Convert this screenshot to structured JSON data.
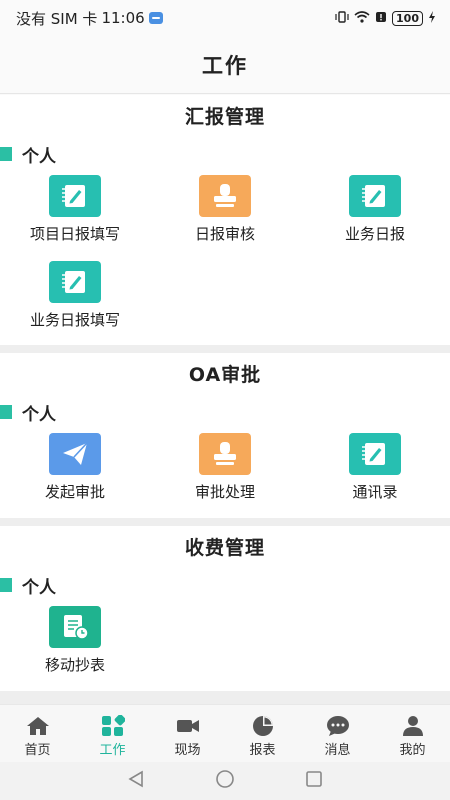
{
  "status_bar": {
    "carrier": "没有 SIM 卡",
    "time": "11:06",
    "battery": "100"
  },
  "header": {
    "title": "工作"
  },
  "sections": [
    {
      "title": "汇报管理",
      "group": "个人",
      "items": [
        {
          "label": "项目日报填写",
          "icon": "notebook-edit-icon",
          "color": "#27bfb1"
        },
        {
          "label": "日报审核",
          "icon": "stamp-icon",
          "color": "#f6a95a"
        },
        {
          "label": "业务日报",
          "icon": "notebook-edit-icon",
          "color": "#27bfb1"
        },
        {
          "label": "业务日报填写",
          "icon": "notebook-edit-icon",
          "color": "#27bfb1"
        }
      ]
    },
    {
      "title": "OA审批",
      "group": "个人",
      "items": [
        {
          "label": "发起审批",
          "icon": "paper-plane-icon",
          "color": "#5b9ae9"
        },
        {
          "label": "审批处理",
          "icon": "stamp-icon",
          "color": "#f6a95a"
        },
        {
          "label": "通讯录",
          "icon": "notebook-edit-icon",
          "color": "#27bfb1"
        }
      ]
    },
    {
      "title": "收费管理",
      "group": "个人",
      "items": [
        {
          "label": "移动抄表",
          "icon": "meter-reading-icon",
          "color": "#1fb38f"
        }
      ]
    }
  ],
  "bottom_nav": {
    "active": "工作",
    "items": [
      {
        "label": "首页",
        "icon": "home-icon"
      },
      {
        "label": "工作",
        "icon": "grid-apps-icon"
      },
      {
        "label": "现场",
        "icon": "video-camera-icon"
      },
      {
        "label": "报表",
        "icon": "pie-chart-icon"
      },
      {
        "label": "消息",
        "icon": "chat-bubble-icon"
      },
      {
        "label": "我的",
        "icon": "user-icon"
      }
    ]
  },
  "accent_color": "#20b49c"
}
